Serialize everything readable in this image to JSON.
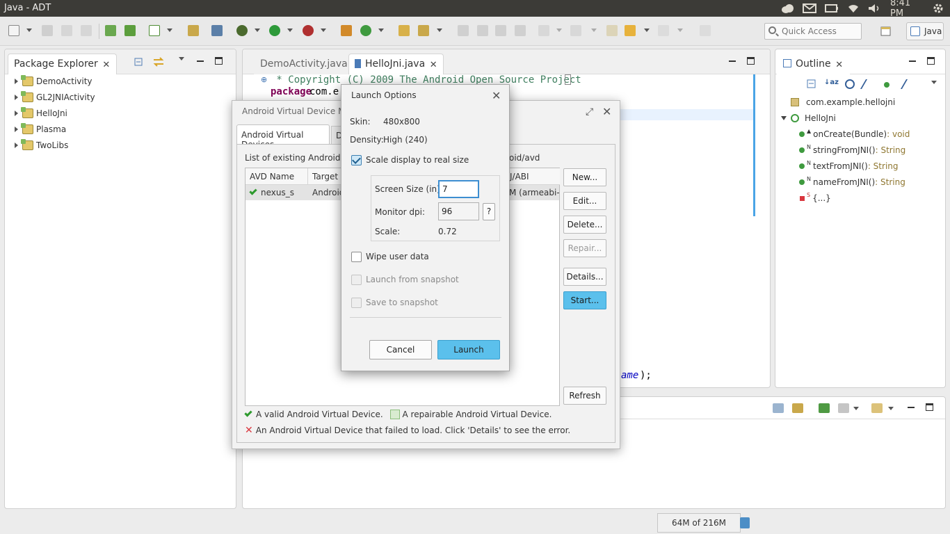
{
  "window": {
    "title": "Java - ADT"
  },
  "tray": {
    "clock": "8:41 PM"
  },
  "toolbar": {
    "quick_access_placeholder": "Quick Access",
    "perspective_label": "Java"
  },
  "package_explorer": {
    "tab_label": "Package Explorer",
    "projects": [
      "DemoActivity",
      "GL2JNIActivity",
      "HelloJni",
      "Plasma",
      "TwoLibs"
    ]
  },
  "editor": {
    "tabs": [
      "DemoActivity.java",
      "HelloJni.java"
    ],
    "active_tab": "HelloJni.java",
    "lines": {
      "comment": " * Copyright (C) 2009 The Android Open Source Project",
      "package_kw": "package",
      "package_name": "com.e",
      "fragment_name": "ame",
      "fragment_tail": ");"
    }
  },
  "outline": {
    "tab_label": "Outline",
    "package": "com.example.hellojni",
    "class": "HelloJni",
    "members": [
      {
        "name": "onCreate(Bundle)",
        "type": " : void",
        "mark": ""
      },
      {
        "name": "stringFromJNI()",
        "type": " : String",
        "mark": "N"
      },
      {
        "name": "textFromJNI()",
        "type": " : String",
        "mark": "N"
      },
      {
        "name": "nameFromJNI()",
        "type": " : String",
        "mark": "N"
      },
      {
        "name": "{...}",
        "type": "",
        "mark": "S"
      }
    ]
  },
  "avd_manager": {
    "title": "Android Virtual Device Man",
    "tabs": [
      "Android Virtual Devices",
      "D"
    ],
    "list_label_prefix": "List of existing Android Vir",
    "list_label_suffix": "oid/avd",
    "columns": [
      "AVD Name",
      "Target N",
      "J/ABI"
    ],
    "rows": [
      {
        "name": "nexus_s",
        "target": "Android",
        "abi": "M (armeabi-v"
      }
    ],
    "buttons": {
      "new": "New...",
      "edit": "Edit...",
      "delete": "Delete...",
      "repair": "Repair...",
      "details": "Details...",
      "start": "Start...",
      "refresh": "Refresh"
    },
    "legend": {
      "valid": "A valid Android Virtual Device.",
      "repairable": "A repairable Android Virtual Device.",
      "failed": "An Android Virtual Device that failed to load. Click 'Details' to see the error."
    }
  },
  "launch_options": {
    "title": "Launch Options",
    "skin_label": "Skin:",
    "skin_value": "480x800",
    "density_label": "Density:",
    "density_value": "High (240)",
    "scale_to_real": {
      "label": "Scale display to real size",
      "checked": true
    },
    "screen_size_label": "Screen Size (in):",
    "screen_size_value": "7",
    "monitor_dpi_label": "Monitor dpi:",
    "monitor_dpi_value": "96",
    "help_button": "?",
    "scale_label": "Scale:",
    "scale_value": "0.72",
    "wipe_user_data": {
      "label": "Wipe user data",
      "checked": false
    },
    "launch_from_snapshot": {
      "label": "Launch from snapshot",
      "enabled": false
    },
    "save_to_snapshot": {
      "label": "Save to snapshot",
      "enabled": false
    },
    "cancel_button": "Cancel",
    "launch_button": "Launch"
  },
  "status_bar": {
    "heap": "64M of 216M"
  },
  "colors": {
    "accent": "#5bc0ec",
    "keyword": "#7f0055",
    "comment": "#3f7f5f",
    "type_annotation": "#8f7731"
  }
}
